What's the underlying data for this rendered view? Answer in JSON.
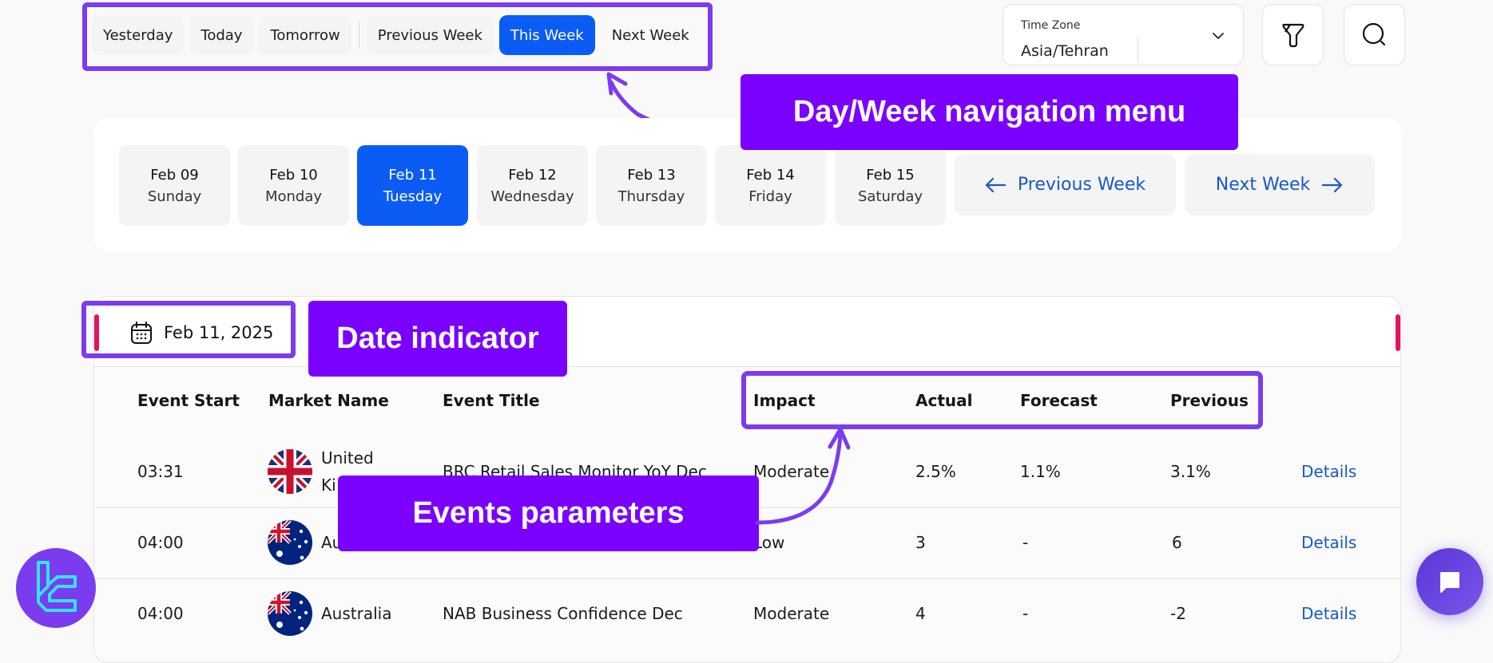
{
  "quick_nav": {
    "items": [
      "Yesterday",
      "Today",
      "Tomorrow",
      "Previous Week",
      "This Week",
      "Next Week"
    ],
    "active": "This Week"
  },
  "time_zone": {
    "label": "Time Zone",
    "value": "Asia/Tehran"
  },
  "icons": {
    "filter": "filter-icon",
    "search": "search-icon"
  },
  "days": [
    {
      "date": "Feb 09",
      "weekday": "Sunday"
    },
    {
      "date": "Feb 10",
      "weekday": "Monday"
    },
    {
      "date": "Feb 11",
      "weekday": "Tuesday",
      "active": true
    },
    {
      "date": "Feb 12",
      "weekday": "Wednesday"
    },
    {
      "date": "Feb 13",
      "weekday": "Thursday"
    },
    {
      "date": "Feb 14",
      "weekday": "Friday"
    },
    {
      "date": "Feb 15",
      "weekday": "Saturday"
    }
  ],
  "week_nav": {
    "previous": "Previous Week",
    "next": "Next Week"
  },
  "date_indicator": "Feb 11, 2025",
  "table": {
    "headers": [
      "Event Start",
      "Market Name",
      "Event Title",
      "Impact",
      "Actual",
      "Forecast",
      "Previous"
    ],
    "rows": [
      {
        "start": "03:31",
        "market": "United Kingdom",
        "market_visible": [
          "United",
          "Ki"
        ],
        "title": "BRC Retail Sales Monitor YoY Dec",
        "impact": "Moderate",
        "actual": "2.5%",
        "forecast": "1.1%",
        "previous": "3.1%",
        "link": "Details"
      },
      {
        "start": "04:00",
        "market": "Australia",
        "market_visible": [
          "Au"
        ],
        "title": "",
        "impact": "Low",
        "actual": "3",
        "forecast": "-",
        "previous": "6",
        "link": "Details"
      },
      {
        "start": "04:00",
        "market": "Australia",
        "title": "NAB Business Confidence Dec",
        "impact": "Moderate",
        "actual": "4",
        "forecast": "-",
        "previous": "-2",
        "link": "Details"
      }
    ]
  },
  "annotations": {
    "nav_menu": "Day/Week navigation menu",
    "date_indicator": "Date indicator",
    "events_parameters": "Events parameters"
  },
  "colors": {
    "accent_blue": "#0a5cf5",
    "link_blue": "#1858c9",
    "annotation_purple": "#7a00ff",
    "highlight_border": "#7b3cf0",
    "marker_red": "#e8125a"
  }
}
